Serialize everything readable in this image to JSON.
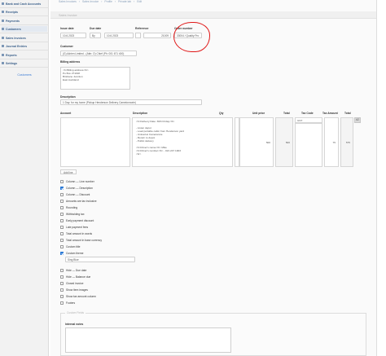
{
  "sidebar": {
    "items": [
      {
        "label": "Bank and Cash Accounts",
        "icon": "bank-icon"
      },
      {
        "label": "Receipts",
        "icon": "receipt-icon"
      },
      {
        "label": "Payments",
        "icon": "payment-icon"
      },
      {
        "label": "Customers",
        "icon": "customers-icon"
      },
      {
        "label": "Sales Invoices",
        "icon": "invoice-icon"
      },
      {
        "label": "Journal Entries",
        "icon": "journal-icon"
      },
      {
        "label": "Reports",
        "icon": "reports-icon"
      },
      {
        "label": "Settings",
        "icon": "settings-icon"
      }
    ],
    "sub_link": "Customers"
  },
  "breadcrumb": [
    "Sales Invoices",
    "Sales Invoice",
    "Profile",
    "Private lab",
    "Edit"
  ],
  "page_title": "Sales Invoice",
  "form": {
    "issue_date_label": "Issue date",
    "issue_date_value": "10.6.2023",
    "due_date_label": "Due date",
    "due_date_option": "By",
    "due_date_value": "10.6.2023",
    "reference_label": "Reference",
    "reference_value": "21009",
    "order_number_label": "Order number",
    "order_number_value": "33004 / Quality Pro",
    "customer_label": "Customer",
    "customer_value": "(G) Adrien Limited - (Attn: O) Chief (Ph: 001 671 400)",
    "billing_address_label": "Billing address",
    "billing_address_value": "<b>Billing address</b>\nPo Box 271198\nBrisbane Junction\nEast Auckland",
    "description_label": "Description",
    "description_value": "1 Day: for my home (Pickup Henderson Delivery Camelonnorie)"
  },
  "table": {
    "headers": {
      "account": "Account",
      "description": "Description",
      "qty": "Qty",
      "unit_price": "Unit price",
      "total": "Total",
      "tax_code": "Tax Code",
      "tax_amount": "Tax Amount",
      "total2": "Total"
    },
    "row": {
      "description": "<b>Delivery Date: 30th Friday</b>\n\n- Listen depot\n- Load portable cabin from Henderson yard\n- Unload at Camelonnie\n- Return to depot\n- Public delivery\n\n<b>Driver's name</b> Mike\n<b>Driver's number</b> - 021 247 1903\n<br>",
      "qty": "",
      "unit_price": "500",
      "total": "500",
      "tax_code": "GST",
      "tax_amount": "75",
      "total2": "575"
    },
    "plus_button": "#2",
    "add_line": "Add line"
  },
  "options": [
    {
      "label": "Column — Line number",
      "checked": false
    },
    {
      "label": "Column — Description",
      "checked": true
    },
    {
      "label": "Column — Discount",
      "checked": false
    },
    {
      "label": "Amounts are tax inclusive",
      "checked": false
    },
    {
      "label": "Rounding",
      "checked": false
    },
    {
      "label": "Withholding tax",
      "checked": false
    },
    {
      "label": "Early payment discount",
      "checked": false
    },
    {
      "label": "Late payment fees",
      "checked": false
    },
    {
      "label": "Total amount in words",
      "checked": false
    },
    {
      "label": "Total amount in base currency",
      "checked": false
    },
    {
      "label": "Custom title",
      "checked": false
    },
    {
      "label": "Custom theme",
      "checked": true
    }
  ],
  "theme_select": "Sing Blue",
  "options2": [
    {
      "label": "Hide — Due date",
      "checked": false
    },
    {
      "label": "Hide — Balance due",
      "checked": false
    },
    {
      "label": "Closed invoice",
      "checked": false
    },
    {
      "label": "Show item images",
      "checked": false
    },
    {
      "label": "Show tax amount column",
      "checked": false
    },
    {
      "label": "Footers",
      "checked": false
    }
  ],
  "custom_fields": {
    "legend": "Custom Fields",
    "internal_notes_label": "Internal notes"
  },
  "colors": {
    "annotation": "#e01818",
    "checkbox_on": "#2a79d6",
    "sidebar_text": "#3a5f8a"
  }
}
